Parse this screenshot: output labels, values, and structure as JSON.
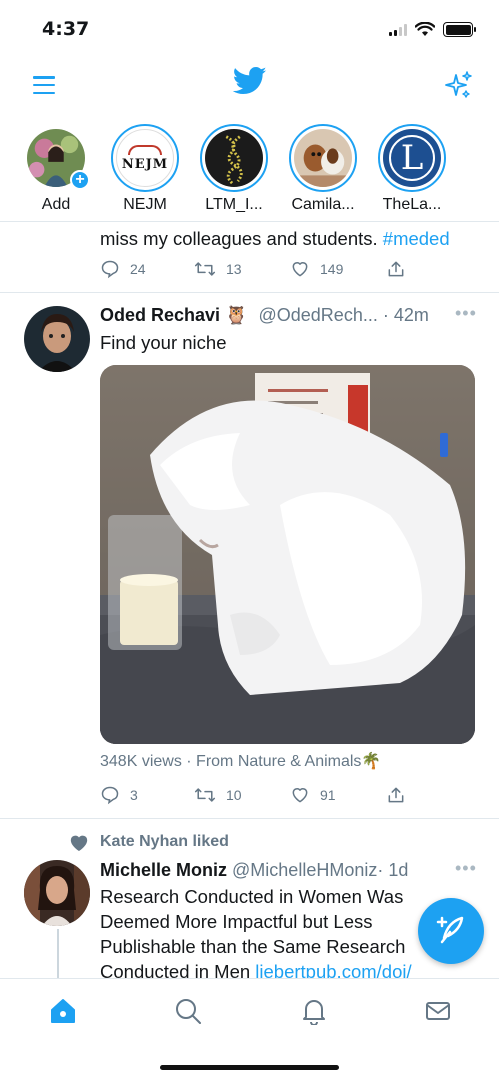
{
  "status": {
    "time": "4:37"
  },
  "fleets": [
    {
      "label": "Add"
    },
    {
      "label": "NEJM"
    },
    {
      "label": "LTM_I..."
    },
    {
      "label": "Camila..."
    },
    {
      "label": "TheLa..."
    }
  ],
  "nejm_badge": "NEJM",
  "la_badge": "L",
  "tweet0": {
    "text": "miss my colleagues and students.",
    "hashtag": "#meded",
    "replies": "24",
    "retweets": "13",
    "likes": "149"
  },
  "tweet1": {
    "name": "Oded Rechavi",
    "emoji": "🦉",
    "handle": "@OdedRech...",
    "time": "· 42m",
    "text": "Find your niche",
    "views": "348K views · From Nature & Animals",
    "views_emoji": "🌴",
    "replies": "3",
    "retweets": "10",
    "likes": "91"
  },
  "tweet2": {
    "social_context": "Kate Nyhan liked",
    "name": "Michelle Moniz",
    "handle": "@MichelleHMoniz",
    "time": "· 1d",
    "text_lines": [
      "Research Conducted in Women Was",
      "Deemed More Impactful but Less",
      "Publishable than the Same Research"
    ],
    "last_line": "Conducted in Men",
    "link": "liebertpub.com/doi/"
  },
  "colors": {
    "accent": "#1da1f2",
    "muted": "#657786"
  },
  "icons": [
    "menu-icon",
    "twitter-bird-icon",
    "sparkle-icon",
    "reply-icon",
    "retweet-icon",
    "like-icon",
    "share-icon",
    "home-icon",
    "search-icon",
    "notifications-icon",
    "messages-icon",
    "compose-icon"
  ]
}
